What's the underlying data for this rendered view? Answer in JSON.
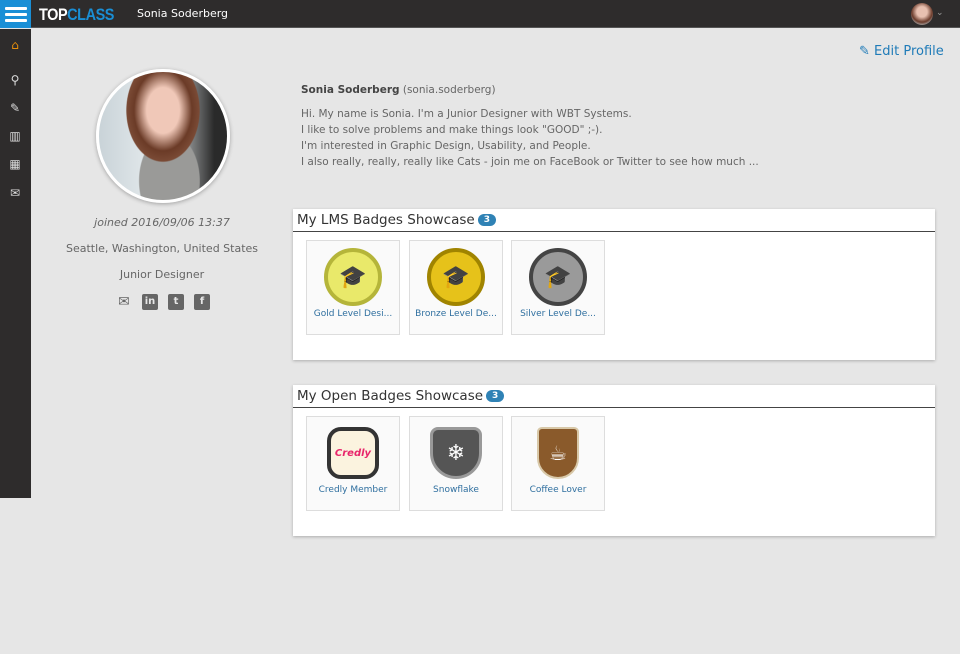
{
  "header": {
    "logo_top": "TOP",
    "logo_class": "CLASS",
    "username": "Sonia Soderberg"
  },
  "sidebar": {
    "items": [
      "home-icon",
      "search-icon",
      "edit-icon",
      "catalog-icon",
      "calendar-icon",
      "mail-icon"
    ],
    "active_color": "#e8900c"
  },
  "edit_profile": "Edit Profile",
  "profile": {
    "joined": "joined 2016/09/06 13:37",
    "location": "Seattle, Washington, United States",
    "role": "Junior Designer",
    "social": [
      "mail-icon",
      "linkedin-icon",
      "twitter-icon",
      "facebook-icon"
    ]
  },
  "bio": {
    "name": "Sonia Soderberg",
    "handle": "(sonia.soderberg)",
    "lines": [
      "Hi. My name is Sonia. I'm a Junior Designer with WBT Systems.",
      "I like to solve problems and make things look \"GOOD\" ;-).",
      "I'm interested in Graphic Design, Usability, and People.",
      "I also really, really, really like Cats - join me on FaceBook or Twitter to see how much ..."
    ]
  },
  "lms": {
    "title": "My LMS Badges Showcase",
    "count": "3",
    "badges": [
      {
        "label": "Gold Level Desi...",
        "fill": "#e9e96a",
        "ring": "#b5b53a"
      },
      {
        "label": "Bronze Level De...",
        "fill": "#e6c21a",
        "ring": "#a08400"
      },
      {
        "label": "Silver Level De...",
        "fill": "#9a9a9a",
        "ring": "#444444"
      }
    ]
  },
  "open": {
    "title": "My Open Badges Showcase",
    "count": "3",
    "badges": [
      {
        "label": "Credly Member",
        "art": "Credly"
      },
      {
        "label": "Snowflake",
        "art": "❄"
      },
      {
        "label": "Coffee Lover",
        "art": "☕"
      }
    ]
  }
}
